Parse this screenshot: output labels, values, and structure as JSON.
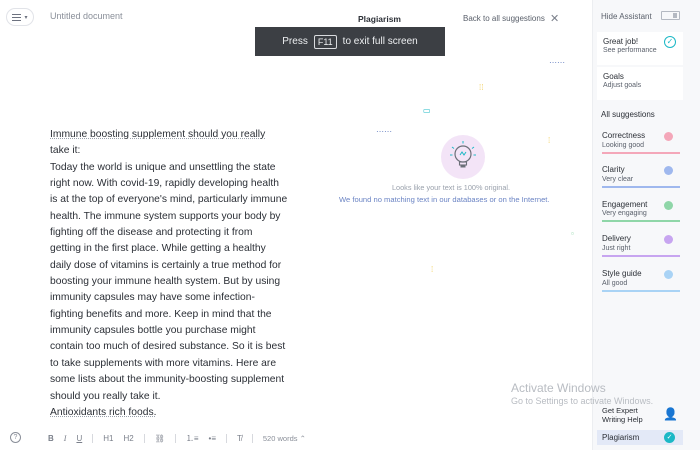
{
  "document": {
    "title": "Untitled document",
    "paragraphs": [
      "Immune boosting supplement should you really",
      "take it:",
      "Today the world is unique and unsettling the state",
      "right now. With covid-19, rapidly developing health",
      "is at the top of everyone's mind, particularly immune",
      "health. The immune system supports your body by",
      "fighting off the disease and protecting it from",
      "getting in the first place. While getting a healthy",
      "daily dose of vitamins is certainly a true method for",
      "boosting your immune health system. But by using",
      "immunity capsules may have some infection-",
      "fighting benefits and more. Keep in mind that the",
      "immunity capsules bottle you purchase might",
      "contain too much of desired substance. So it is best",
      "to take supplements with more vitamins. Here are",
      "some lists about the immunity-boosting supplement",
      "should you really take it.",
      "Antioxidants rich foods."
    ]
  },
  "toolbar": {
    "help": "?",
    "bold": "B",
    "italic": "I",
    "underline": "U",
    "h1": "H1",
    "h2": "H2",
    "link": "⛓",
    "ordered_list": "⒈≡",
    "bullet_list": "•≡",
    "clear_format": "T̸",
    "word_count": "520 words ⌃"
  },
  "toast": {
    "prefix": "Press",
    "key": "F11",
    "suffix": "to exit full screen"
  },
  "plagiarism_panel": {
    "title": "Plagiarism",
    "back_link": "Back to all suggestions",
    "close": "✕",
    "message_primary": "Looks like your text is 100% original.",
    "message_secondary": "We found no matching text in our databases or on the Internet."
  },
  "assistant": {
    "hide_label": "Hide Assistant",
    "performance": {
      "title": "Great job!",
      "subtitle": "See performance"
    },
    "goals": {
      "title": "Goals",
      "subtitle": "Adjust goals"
    },
    "all_suggestions": "All suggestions",
    "categories": [
      {
        "name": "Correctness",
        "status": "Looking good",
        "color": "#f4a7b9"
      },
      {
        "name": "Clarity",
        "status": "Very clear",
        "color": "#9fb8ee"
      },
      {
        "name": "Engagement",
        "status": "Very engaging",
        "color": "#8fd6a8"
      },
      {
        "name": "Delivery",
        "status": "Just right",
        "color": "#c7a5f0"
      },
      {
        "name": "Style guide",
        "status": "All good",
        "color": "#a9d3f5"
      }
    ],
    "get_expert_line1": "Get Expert",
    "get_expert_line2": "Writing Help",
    "plagiarism_label": "Plagiarism"
  },
  "watermark": {
    "title": "Activate Windows",
    "subtitle": "Go to Settings to activate Windows."
  },
  "colors": {
    "accent_teal": "#1cb8c6",
    "link_blue": "#6b84c4",
    "toast_bg": "#3c3f44",
    "sidebar_bg": "#f7f8fa"
  },
  "icons": [
    "menu-icon",
    "close-icon",
    "check-icon",
    "lightbulb-icon",
    "expert-icon",
    "help-icon",
    "link-icon"
  ]
}
